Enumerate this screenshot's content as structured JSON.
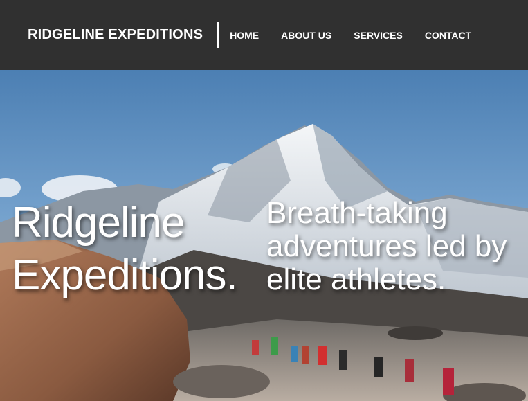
{
  "navbar": {
    "brand": "RIDGELINE EXPEDITIONS",
    "links": [
      {
        "label": "HOME"
      },
      {
        "label": "ABOUT US"
      },
      {
        "label": "SERVICES"
      },
      {
        "label": "CONTACT"
      }
    ]
  },
  "hero": {
    "title_line1": "Ridgeline",
    "title_line2": "Expeditions.",
    "tagline": "Breath-taking adventures led by elite athletes."
  },
  "colors": {
    "navbar_bg": "#303030",
    "text": "#ffffff",
    "sky": "#5f8fc0"
  }
}
